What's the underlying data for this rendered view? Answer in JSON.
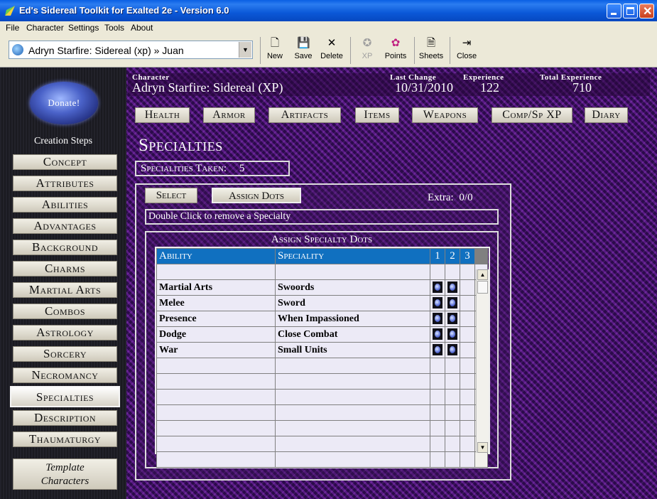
{
  "window": {
    "title": "Ed's Sidereal Toolkit for Exalted 2e - Version 6.0"
  },
  "menu": [
    "File",
    "Character",
    "Settings",
    "Tools",
    "About"
  ],
  "toolbar": {
    "character_select": "Adryn Starfire: Sidereal (xp) » Juan",
    "buttons": {
      "new": "New",
      "save": "Save",
      "delete": "Delete",
      "xp": "XP",
      "points": "Points",
      "sheets": "Sheets",
      "close": "Close"
    }
  },
  "sidebar": {
    "donate": "Donate!",
    "creation_steps_title": "Creation Steps",
    "steps": [
      "Concept",
      "Attributes",
      "Abilities",
      "Advantages",
      "Background",
      "Charms",
      "Martial Arts",
      "Combos",
      "Astrology",
      "Sorcery",
      "Necromancy",
      "Specialties",
      "Description",
      "Thaumaturgy"
    ],
    "active_step": "Specialties",
    "template_line1": "Template",
    "template_line2": "Characters"
  },
  "header": {
    "character_label": "Character",
    "character_value": "Adryn Starfire: Sidereal (XP)",
    "last_change_label": "Last Change",
    "last_change_value": "10/31/2010",
    "experience_label": "Experience",
    "experience_value": "122",
    "total_experience_label": "Total Experience",
    "total_experience_value": "710"
  },
  "tabs": [
    "Health",
    "Armor",
    "Artifacts",
    "Items",
    "Weapons",
    "Comp/Sp XP",
    "Diary"
  ],
  "section": {
    "title": "Specialties",
    "taken_label": "Specialities Taken:",
    "taken_value": "5",
    "select_button": "Select",
    "assign_button": "Assign Dots",
    "extra_label": "Extra:",
    "extra_value": "0/0",
    "hint": "Double Click to remove a Specialty",
    "assign_title": "Assign Specialty Dots"
  },
  "grid": {
    "headers": [
      "Ability",
      "Speciality",
      "1",
      "2",
      "3"
    ],
    "rows": [
      {
        "ability": "Martial Arts",
        "speciality": "Swoords",
        "dots": 2
      },
      {
        "ability": "Melee",
        "speciality": "Sword",
        "dots": 2
      },
      {
        "ability": "Presence",
        "speciality": "When Impassioned",
        "dots": 2
      },
      {
        "ability": "Dodge",
        "speciality": "Close Combat",
        "dots": 2
      },
      {
        "ability": "War",
        "speciality": "Small Units",
        "dots": 2
      }
    ],
    "empty_rows": 7
  },
  "colors": {
    "titlebar": "#0b58d8",
    "grid_header": "#1070c0",
    "background": "#3a0e5e"
  }
}
